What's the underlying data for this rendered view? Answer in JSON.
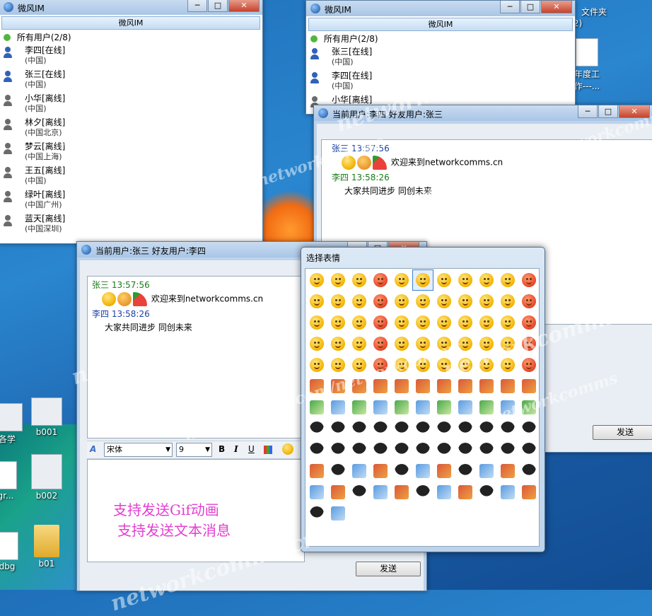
{
  "desktop": {
    "icons": [
      {
        "label": "文件夹"
      },
      {
        "label": "年度工"
      },
      {
        "label": "作---..."
      },
      {
        "label": "各学"
      },
      {
        "label": "b001"
      },
      {
        "label": "gr..."
      },
      {
        "label": "b002"
      },
      {
        "label": "dbg"
      },
      {
        "label": "b01"
      },
      {
        "label": "2)"
      }
    ]
  },
  "contact_window_left": {
    "title": "微风IM",
    "header": "微风IM",
    "group_label": "所有用户(2/8)",
    "contacts": [
      {
        "name": "李四[在线]",
        "location": "(中国)",
        "status": "online"
      },
      {
        "name": "张三[在线]",
        "location": "(中国)",
        "status": "online"
      },
      {
        "name": "小华[离线]",
        "location": "(中国)",
        "status": "offline"
      },
      {
        "name": "林夕[离线]",
        "location": "(中国北京)",
        "status": "offline"
      },
      {
        "name": "梦云[离线]",
        "location": "(中国上海)",
        "status": "offline"
      },
      {
        "name": "王五[离线]",
        "location": "(中国)",
        "status": "offline"
      },
      {
        "name": "绿叶[离线]",
        "location": "(中国广州)",
        "status": "offline"
      },
      {
        "name": "蓝天[离线]",
        "location": "(中国深圳)",
        "status": "offline"
      }
    ]
  },
  "contact_window_right": {
    "title": "微风IM",
    "header": "微风IM",
    "group_label": "所有用户(2/8)",
    "contacts": [
      {
        "name": "张三[在线]",
        "location": "(中国)",
        "status": "online"
      },
      {
        "name": "李四[在线]",
        "location": "(中国)",
        "status": "online"
      },
      {
        "name": "小华[离线]",
        "location": "",
        "status": "offline"
      }
    ]
  },
  "chat_right": {
    "title": "当前用户:李四  好友用户:张三",
    "messages": [
      {
        "sender": "张三",
        "time": "13:57:56",
        "text": "欢迎来到networkcomms.cn",
        "emoji_count": 3
      },
      {
        "sender": "李四",
        "time": "13:58:26",
        "text": "大家共同进步 同创未来"
      }
    ],
    "send_label": "发送"
  },
  "chat_left": {
    "title": "当前用户:张三  好友用户:李四",
    "messages": [
      {
        "sender": "张三",
        "time": "13:57:56",
        "text": "欢迎来到networkcomms.cn",
        "emoji_count": 3
      },
      {
        "sender": "李四",
        "time": "13:58:26",
        "text": "大家共同进步 同创未来"
      }
    ],
    "font_name": "宋体",
    "font_size": "9",
    "bold": "B",
    "italic": "I",
    "underline": "U",
    "overlay_line1": "支持发送Gif动画",
    "overlay_line2": "支持发送文本消息",
    "send_label": "发送"
  },
  "emoji_picker": {
    "title": "选择表情",
    "selected_index": 5,
    "cell_count": 123
  },
  "watermarks": [
    "networkcomms",
    "www.cnblogs.com/networkcomms",
    "networkcomms.cn"
  ]
}
